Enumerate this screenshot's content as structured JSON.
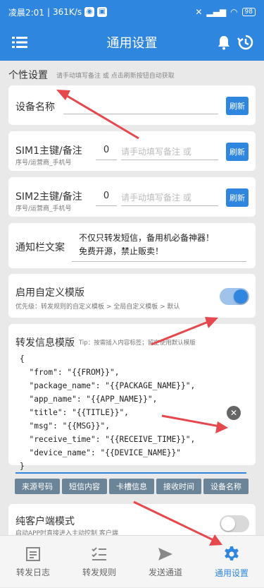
{
  "status": {
    "time": "凌晨2:01",
    "speed": "361K/s",
    "battery": "98"
  },
  "appbar": {
    "title": "通用设置"
  },
  "section": {
    "title": "个性设置",
    "hint": "请手动填写备注 或 点击刷新按钮自动获取"
  },
  "device": {
    "label": "设备名称",
    "refresh": "刷新"
  },
  "sim1": {
    "label": "SIM1主键/备注",
    "sub": "序号/运营商_手机号",
    "value": "0",
    "placeholder": "请手动填写备注 或",
    "refresh": "刷新"
  },
  "sim2": {
    "label": "SIM2主键/备注",
    "sub": "序号/运营商_手机号",
    "value": "0",
    "placeholder": "请手动填写备注 或",
    "refresh": "刷新"
  },
  "notify": {
    "label": "通知栏文案",
    "line1": "不仅只转发短信，备用机必备神器！",
    "line2": "免费开源，禁止贩卖！"
  },
  "custom": {
    "label": "启用自定义模版",
    "sub": "优先级：转发规则的自定义模板 > 全局自定义模板 > 默认",
    "enabled": true
  },
  "template": {
    "label": "转发信息模版",
    "tip": "Tip：按需插入内容标签；留空使用默认模版",
    "body": "{\n  \"from\": \"{{FROM}}\",\n  \"package_name\": \"{{PACKAGE_NAME}}\",\n  \"app_name\": \"{{APP_NAME}}\",\n  \"title\": \"{{TITLE}}\",\n  \"msg\": \"{{MSG}}\",\n  \"receive_time\": \"{{RECEIVE_TIME}}\",\n  \"device_name\": \"{{DEVICE_NAME}}\"\n}",
    "chips": [
      "来源号码",
      "短信内容",
      "卡槽信息",
      "接收时间",
      "设备名称"
    ]
  },
  "client": {
    "label": "纯客户端模式",
    "sub": "启动APP时直接进入主动控制 客户端",
    "enabled": false
  },
  "nav": [
    {
      "label": "转发日志",
      "icon": "log-icon"
    },
    {
      "label": "转发规则",
      "icon": "rules-icon"
    },
    {
      "label": "发送通道",
      "icon": "send-icon"
    },
    {
      "label": "通用设置",
      "icon": "settings-icon"
    }
  ],
  "colors": {
    "primary": "#2e86de",
    "annotation": "#e5484d"
  }
}
